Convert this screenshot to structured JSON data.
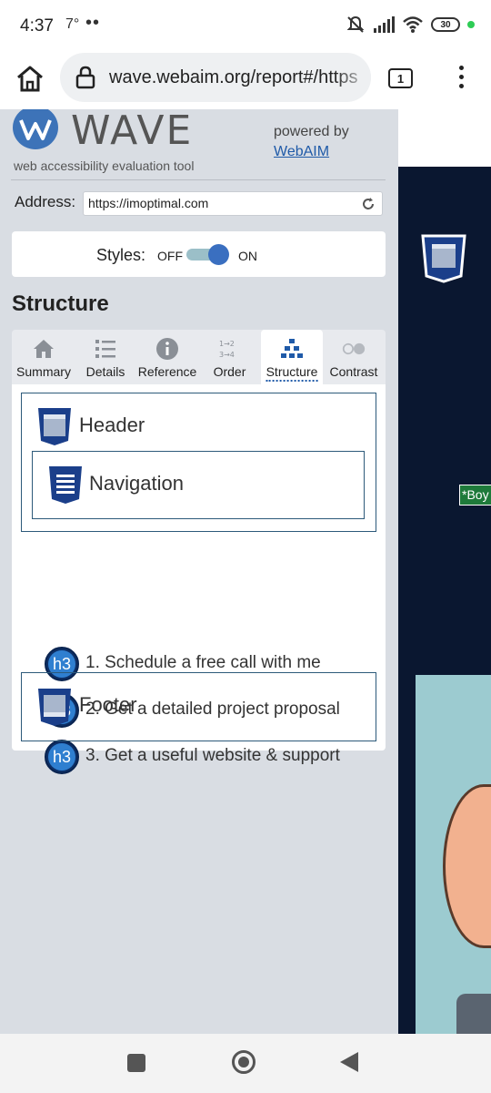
{
  "status_bar": {
    "time": "4:37",
    "temperature": "7°",
    "notification_dots": "••",
    "battery": "30"
  },
  "browser": {
    "url": "wave.webaim.org/report#/https",
    "tab_count": "1"
  },
  "wave": {
    "logo_text": "WAVE",
    "tagline": "web accessibility evaluation tool",
    "powered_by": "powered by",
    "powered_link": "WebAIM",
    "address_label": "Address:",
    "address_value": "https://imoptimal.com",
    "styles_label": "Styles:",
    "styles_off": "OFF",
    "styles_on": "ON",
    "section_title": "Structure",
    "tabs": [
      {
        "label": "Summary",
        "icon": "home-icon"
      },
      {
        "label": "Details",
        "icon": "list-icon"
      },
      {
        "label": "Reference",
        "icon": "info-icon"
      },
      {
        "label": "Order",
        "icon": "order-icon"
      },
      {
        "label": "Structure",
        "icon": "structure-icon",
        "active": true
      },
      {
        "label": "Contrast",
        "icon": "contrast-icon"
      }
    ],
    "structure": {
      "header": "Header",
      "navigation": "Navigation",
      "headings": [
        {
          "level": "h3",
          "text": "1. Schedule a free call with me"
        },
        {
          "level": "h3",
          "text": "2. Get a detailed project proposal"
        },
        {
          "level": "h3",
          "text": "3. Get a useful website & support"
        }
      ],
      "footer": "Footer"
    }
  },
  "preview": {
    "boy_tag": "*Boy"
  },
  "colors": {
    "accent": "#1f5aa8",
    "panel_bg": "#d9dde3",
    "preview_dark": "#0a1730"
  }
}
